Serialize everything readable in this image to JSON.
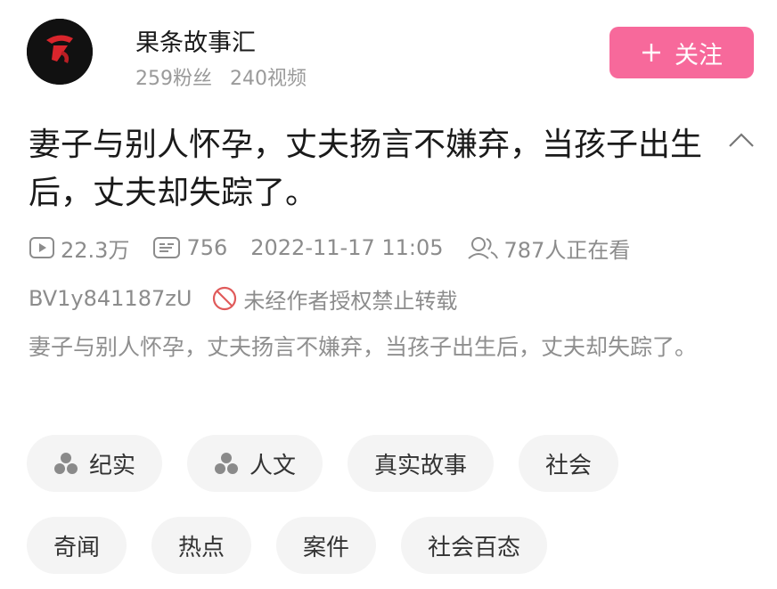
{
  "channel": {
    "name": "果条故事汇",
    "avatar_text": "果条故事汇",
    "followers": "259粉丝",
    "videos": "240视频",
    "follow_label": "关注",
    "follow_icon": "plus-icon",
    "accent_color": "#f7699b"
  },
  "video": {
    "title": "妻子与别人怀孕，丈夫扬言不嫌弃，当孩子出生后，丈夫却失踪了。",
    "views": "22.3万",
    "comments": "756",
    "datetime": "2022-11-17 11:05",
    "watching": "787人正在看",
    "bvid": "BV1y841187zU",
    "copyright_notice": "未经作者授权禁止转载",
    "description": "妻子与别人怀孕，丈夫扬言不嫌弃，当孩子出生后，丈夫却失踪了。"
  },
  "tags": {
    "row1": [
      {
        "label": "纪实",
        "icon": "channel-icon"
      },
      {
        "label": "人文",
        "icon": "channel-icon"
      },
      {
        "label": "真实故事"
      },
      {
        "label": "社会"
      }
    ],
    "row2": [
      {
        "label": "奇闻"
      },
      {
        "label": "热点"
      },
      {
        "label": "案件"
      },
      {
        "label": "社会百态"
      }
    ]
  }
}
